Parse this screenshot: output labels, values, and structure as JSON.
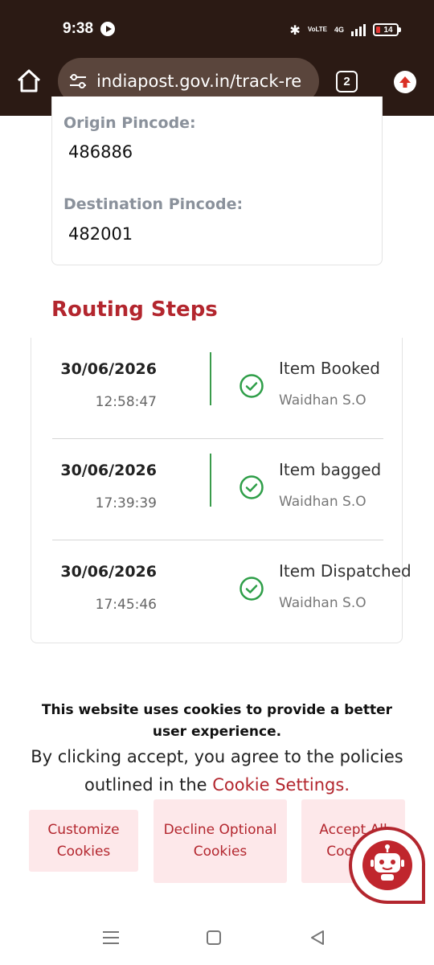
{
  "status_bar": {
    "time": "9:38",
    "volte_label": "VoLTE",
    "network": "4G",
    "battery_level": "14",
    "icons": [
      "play-icon",
      "bluetooth-icon",
      "volte-icon",
      "signal-icon",
      "battery-icon"
    ]
  },
  "browser": {
    "url": "indiapost.gov.in/track-re",
    "tab_count": "2",
    "icons": [
      "home-icon",
      "site-settings-icon",
      "tabs-icon",
      "update-icon"
    ]
  },
  "pincodes": {
    "origin_label": "Origin Pincode:",
    "origin_value": "486886",
    "destination_label": "Destination Pincode:",
    "destination_value": "482001"
  },
  "routing": {
    "title": "Routing Steps",
    "steps": [
      {
        "date": "30/06/2026",
        "time": "12:58:47",
        "status": "Item Booked",
        "office": "Waidhan S.O"
      },
      {
        "date": "30/06/2026",
        "time": "17:39:39",
        "status": "Item bagged",
        "office": "Waidhan S.O"
      },
      {
        "date": "30/06/2026",
        "time": "17:45:46",
        "status": "Item Dispatched",
        "office": "Waidhan S.O"
      }
    ]
  },
  "cookie_banner": {
    "heading": "This website uses cookies to provide a better user experience.",
    "body_prefix": "By clicking accept, you agree to the policies outlined in the ",
    "link_text": "Cookie Settings.",
    "customize_label": "Customize Cookies",
    "decline_label": "Decline Optional Cookies",
    "accept_label": "Accept All Cookies"
  },
  "colors": {
    "brand_red": "#b3262e",
    "chrome_bg": "#2b1a14",
    "success_green": "#2e9e48",
    "button_bg": "#fde8ea"
  },
  "nav_bar": {
    "icons": [
      "recents-icon",
      "home-nav-icon",
      "back-icon"
    ]
  }
}
